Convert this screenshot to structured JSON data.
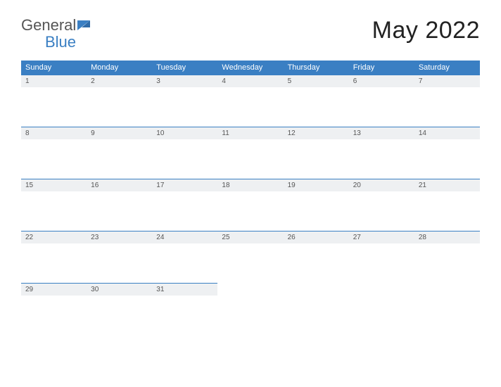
{
  "brand": {
    "part1": "General",
    "part2": "Blue"
  },
  "title": "May 2022",
  "days_of_week": [
    "Sunday",
    "Monday",
    "Tuesday",
    "Wednesday",
    "Thursday",
    "Friday",
    "Saturday"
  ],
  "weeks": [
    [
      "1",
      "2",
      "3",
      "4",
      "5",
      "6",
      "7"
    ],
    [
      "8",
      "9",
      "10",
      "11",
      "12",
      "13",
      "14"
    ],
    [
      "15",
      "16",
      "17",
      "18",
      "19",
      "20",
      "21"
    ],
    [
      "22",
      "23",
      "24",
      "25",
      "26",
      "27",
      "28"
    ],
    [
      "29",
      "30",
      "31",
      "",
      "",
      "",
      ""
    ]
  ]
}
